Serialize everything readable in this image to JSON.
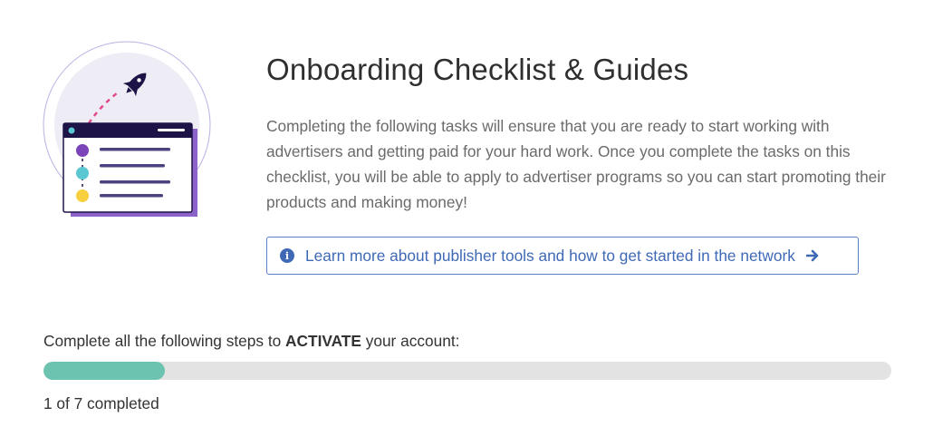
{
  "header": {
    "title": "Onboarding Checklist & Guides",
    "description": "Completing the following tasks will ensure that you are ready to start working with advertisers and getting paid for your hard work. Once you complete the tasks on this checklist, you will be able to apply to advertiser programs so you can start promoting their products and making money!"
  },
  "learn_more": {
    "label": "Learn more about publisher tools and how to get started in the network",
    "icon": "info-circle-icon",
    "arrow_icon": "arrow-right-icon"
  },
  "activation": {
    "prefix": "Complete all the following steps to ",
    "emphasis": "ACTIVATE",
    "suffix": " your account:",
    "completed_steps": 1,
    "total_steps": 7,
    "progress_text": "1 of 7 completed"
  },
  "colors": {
    "accent_blue": "#3f69b5",
    "progress_fill": "#6cc3b0",
    "progress_track": "#e3e3e3",
    "illustration_purple": "#7b44b8",
    "illustration_dark": "#1e1346"
  }
}
